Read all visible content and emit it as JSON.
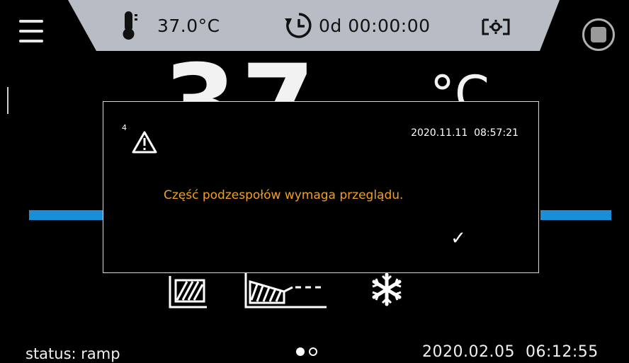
{
  "header": {
    "temperature": "37.0°C",
    "timer": "0d 00:00:00"
  },
  "main": {
    "big_value": "37",
    "unit": "°C"
  },
  "dialog": {
    "number": "4",
    "timestamp": "2020.11.11  08:57:21",
    "message": "Część podzespołów wymaga przeglądu.",
    "ok_label": "✓"
  },
  "footer": {
    "status": "status: ramp",
    "datetime": "2020.02.05  06:12:55"
  },
  "colors": {
    "topbar": "#b8bcc4",
    "accent_blue": "#1a8fd8",
    "message": "#f0a020"
  }
}
